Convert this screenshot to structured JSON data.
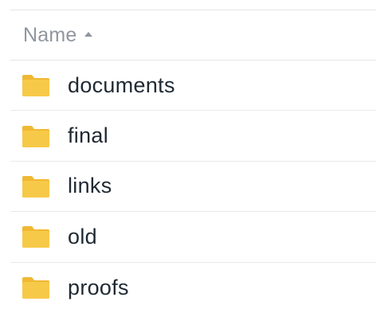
{
  "table": {
    "header": {
      "name_label": "Name",
      "sort_icon": "sort-ascending-icon"
    },
    "rows": [
      {
        "name": "documents",
        "icon": "folder-icon"
      },
      {
        "name": "final",
        "icon": "folder-icon"
      },
      {
        "name": "links",
        "icon": "folder-icon"
      },
      {
        "name": "old",
        "icon": "folder-icon"
      },
      {
        "name": "proofs",
        "icon": "folder-icon"
      }
    ]
  },
  "colors": {
    "folder": "#F7C948",
    "folder_tab": "#F0B833",
    "header_text": "#8F969E",
    "row_text": "#1F2933",
    "divider": "#E3E5E8"
  }
}
